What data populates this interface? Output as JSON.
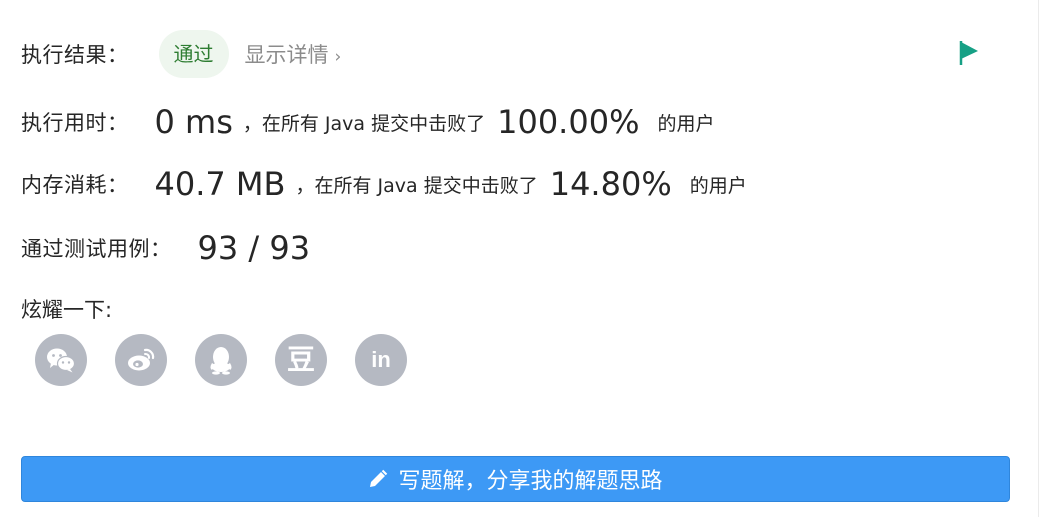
{
  "result": {
    "label": "执行结果：",
    "status": "通过",
    "details_link": "显示详情",
    "details_chevron": "›"
  },
  "runtime": {
    "label": "执行用时：",
    "value": "0 ms",
    "mid_text": "，在所有 Java 提交中击败了",
    "percent": "100.00%",
    "suffix": "的用户"
  },
  "memory": {
    "label": "内存消耗：",
    "value": "40.7 MB",
    "mid_text": "，在所有 Java 提交中击败了",
    "percent": "14.80%",
    "suffix": "的用户"
  },
  "testcases": {
    "label": "通过测试用例：",
    "value": "93 / 93"
  },
  "share": {
    "title": "炫耀一下:",
    "icons": [
      "wechat-icon",
      "weibo-icon",
      "qq-icon",
      "douban-icon",
      "linkedin-icon"
    ],
    "douban_glyph": "豆",
    "linkedin_glyph": "in"
  },
  "write_button": {
    "label": "写题解，分享我的解题思路",
    "icon": "pencil-icon"
  },
  "colors": {
    "accent": "#3d99f5",
    "flag": "#16a085",
    "pass_bg": "#eef6ee",
    "pass_text": "#2e7d32",
    "share_icon_bg": "#b5b9c2"
  }
}
